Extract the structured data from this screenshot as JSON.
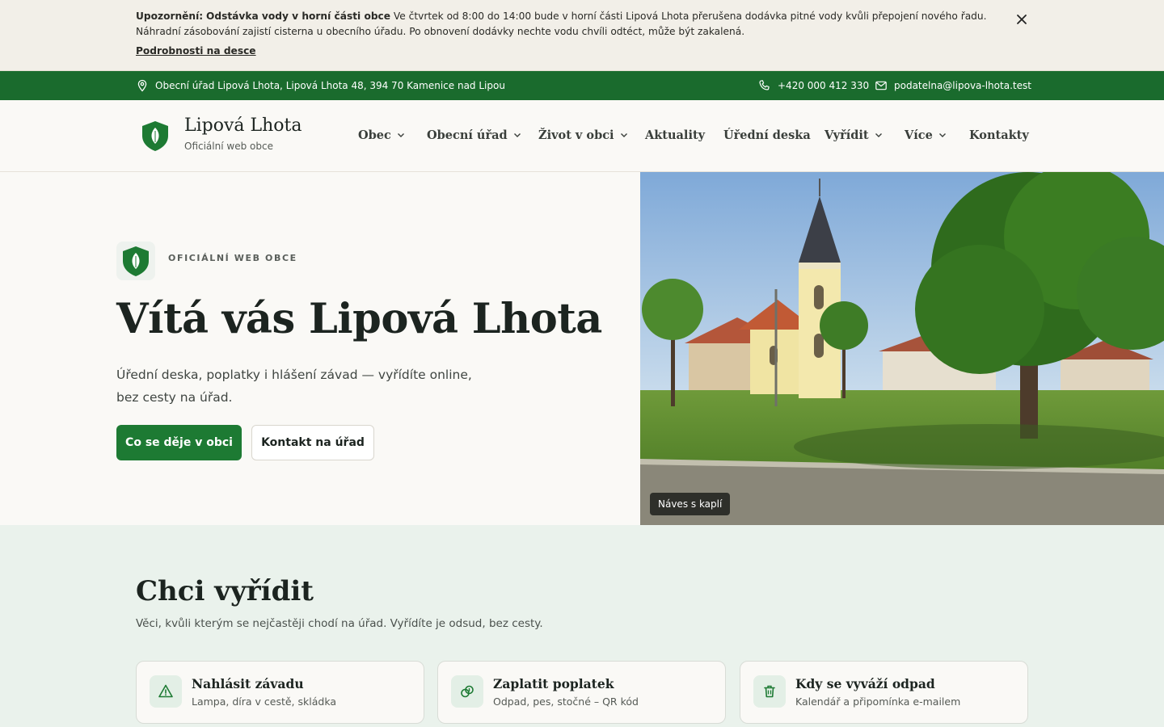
{
  "alert": {
    "prefix": "Upozornění:",
    "headline": "Odstávka vody v horní části obce",
    "body": "Ve čtvrtek od 8:00 do 14:00 bude v horní části Lipová Lhota přerušena dodávka pitné vody kvůli přepojení nového řadu. Náhradní zásobování zajistí cisterna u obecního úřadu. Po obnovení dodávky nechte vodu chvíli odtéct, může být zakalená.",
    "link": "Podrobnosti na desce",
    "close_icon": "close-icon"
  },
  "contact": {
    "address": "Obecní úřad Lipová Lhota, Lipová Lhota 48, 394 70 Kamenice nad Lipou",
    "phone": "+420 000 412 330",
    "email": "podatelna@lipova-lhota.test",
    "icons": [
      "map-pin-icon",
      "phone-icon",
      "mail-icon"
    ]
  },
  "header": {
    "site_name": "Lipová Lhota",
    "tagline": "Oficiální web obce",
    "nav": [
      {
        "label": "Obec",
        "dropdown": true
      },
      {
        "label": "Obecní úřad",
        "dropdown": true
      },
      {
        "label": "Život v obci",
        "dropdown": true
      },
      {
        "label": "Aktuality",
        "dropdown": false
      },
      {
        "label": "Úřední deska",
        "dropdown": false
      },
      {
        "label": "Vyřídit",
        "dropdown": true
      },
      {
        "label": "Více",
        "dropdown": true
      },
      {
        "label": "Kontakty",
        "dropdown": false
      }
    ]
  },
  "hero": {
    "kicker": "OFICIÁLNÍ WEB OBCE",
    "title": "Vítá vás Lipová Lhota",
    "lead": "Úřední deska, poplatky i hlášení závad — vyřídíte online, bez cesty na úřad.",
    "primary_button": "Co se děje v obci",
    "secondary_button": "Kontakt na úřad",
    "photo_caption": "Náves s kaplí"
  },
  "services": {
    "title": "Chci vyřídit",
    "subtitle": "Věci, kvůli kterým se nejčastěji chodí na úřad. Vyřídíte je odsud, bez cesty.",
    "cards": [
      {
        "title": "Nahlásit závadu",
        "desc": "Lampa, díra v cestě, skládka",
        "icon": "warning-icon"
      },
      {
        "title": "Zaplatit poplatek",
        "desc": "Odpad, pes, stočné – QR kód",
        "icon": "coins-icon"
      },
      {
        "title": "Kdy se vyváží odpad",
        "desc": "Kalendář a připomínka e-mailem",
        "icon": "trash-icon"
      }
    ]
  },
  "colors": {
    "brand_green": "#1a6b2d",
    "button_green": "#1d7a33",
    "alert_bg": "#f2efe8",
    "services_bg": "#eaf2ec"
  }
}
